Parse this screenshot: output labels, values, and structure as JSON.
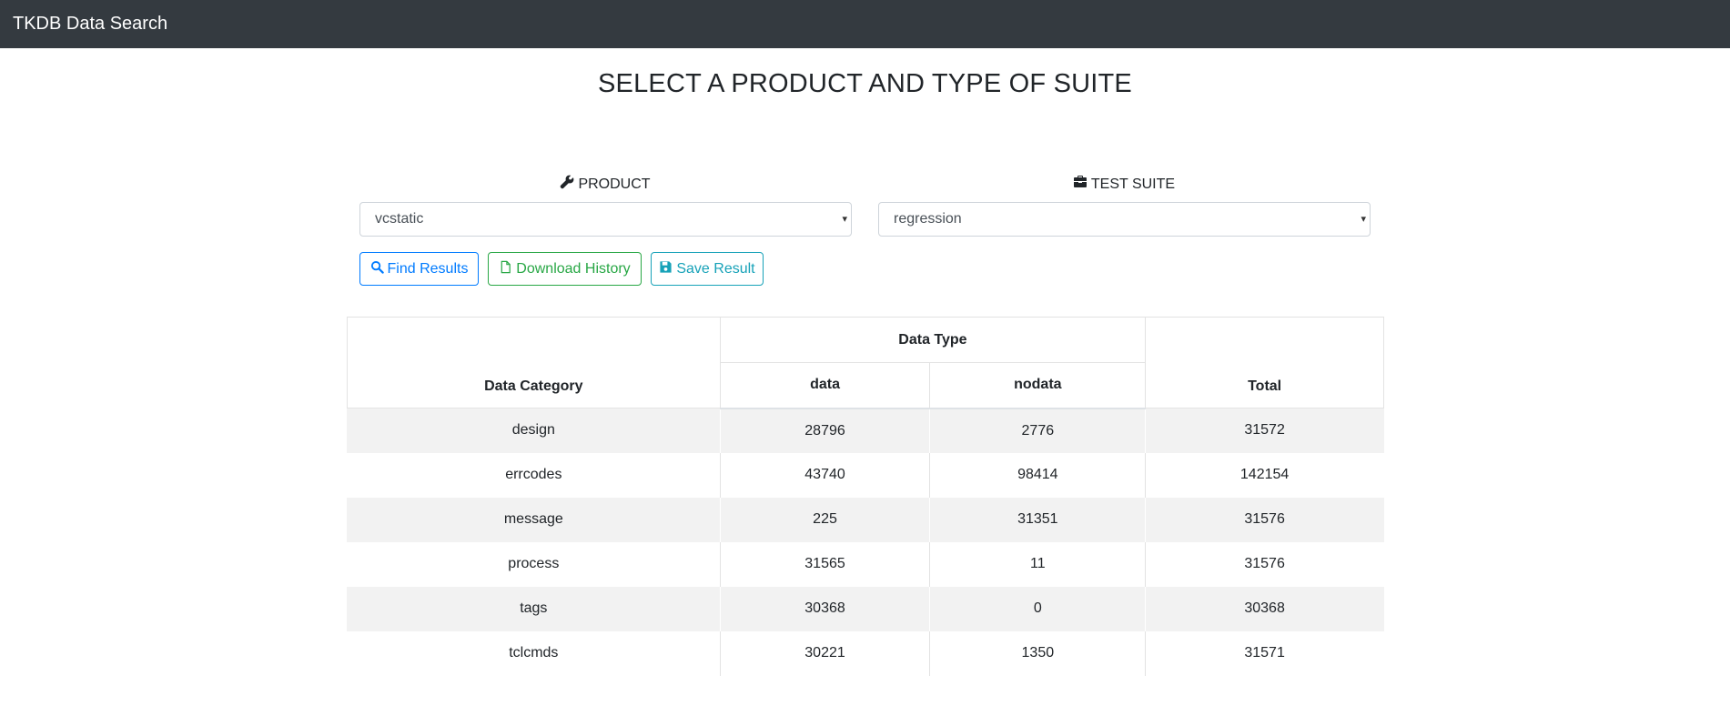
{
  "navbar": {
    "brand": "TKDB Data Search"
  },
  "page": {
    "title": "SELECT A PRODUCT AND TYPE OF SUITE"
  },
  "product": {
    "label": "PRODUCT",
    "icon": "wrench-icon",
    "selected": "vcstatic"
  },
  "suite": {
    "label": "TEST SUITE",
    "icon": "toolbox-icon",
    "selected": "regression"
  },
  "buttons": {
    "find": {
      "label": "Find Results",
      "icon": "search-icon",
      "color": "#007bff"
    },
    "download": {
      "label": "Download History",
      "icon": "file-icon",
      "color": "#28a745"
    },
    "save": {
      "label": "Save Result",
      "icon": "save-icon",
      "color": "#17a2b8"
    }
  },
  "table": {
    "headers": {
      "category": "Data Category",
      "group": "Data Type",
      "data": "data",
      "nodata": "nodata",
      "total": "Total"
    },
    "rows": [
      {
        "category": "design",
        "data": "28796",
        "nodata": "2776",
        "total": "31572"
      },
      {
        "category": "errcodes",
        "data": "43740",
        "nodata": "98414",
        "total": "142154"
      },
      {
        "category": "message",
        "data": "225",
        "nodata": "31351",
        "total": "31576"
      },
      {
        "category": "process",
        "data": "31565",
        "nodata": "11",
        "total": "31576"
      },
      {
        "category": "tags",
        "data": "30368",
        "nodata": "0",
        "total": "30368"
      },
      {
        "category": "tclcmds",
        "data": "30221",
        "nodata": "1350",
        "total": "31571"
      }
    ]
  }
}
